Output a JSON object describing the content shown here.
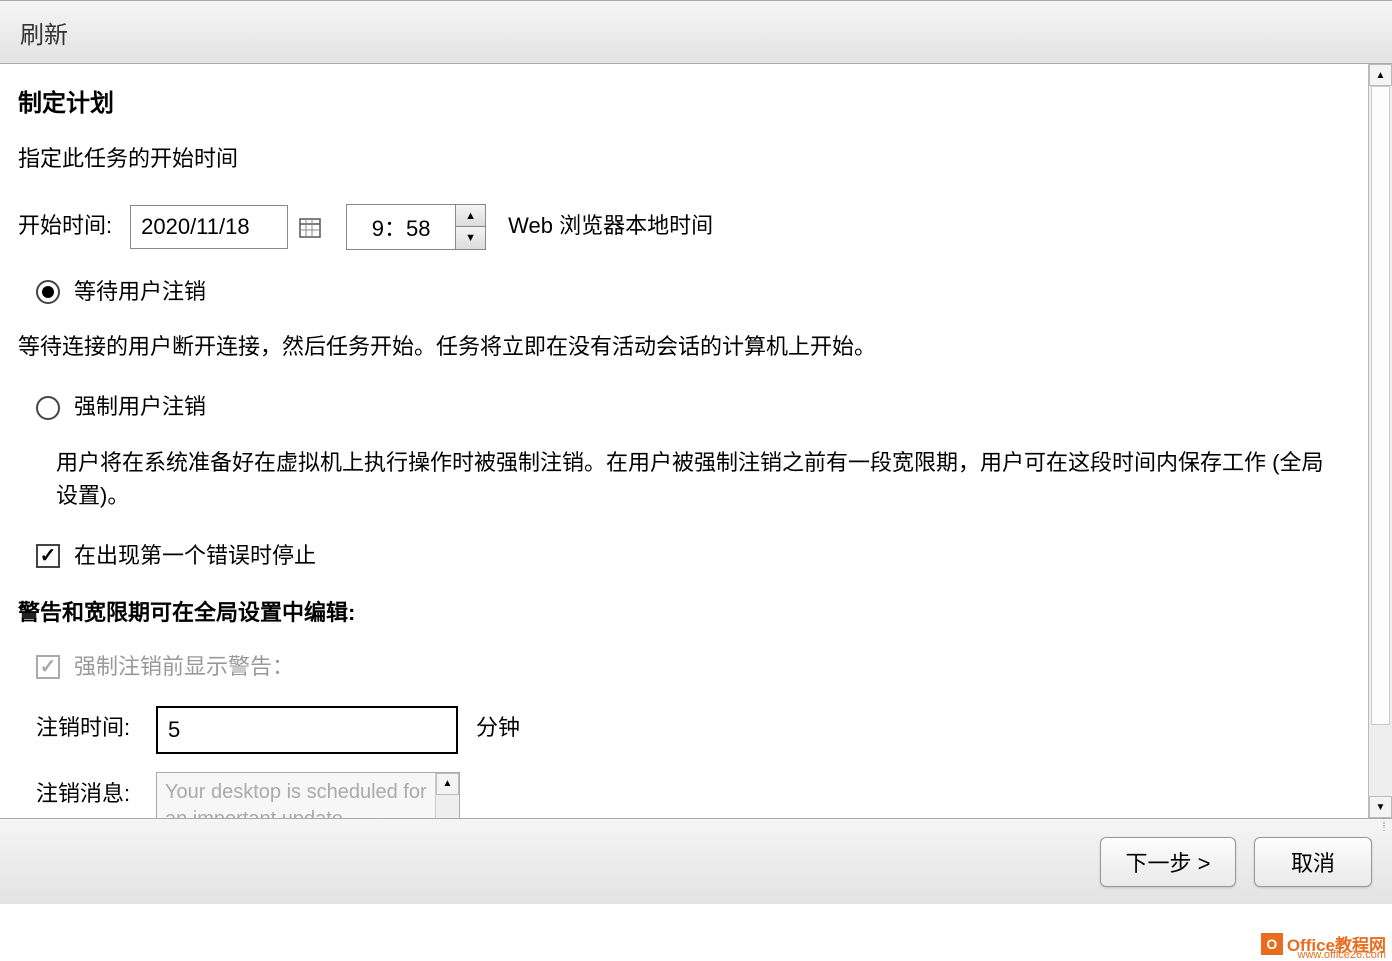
{
  "titlebar": {
    "title": "刷新"
  },
  "plan": {
    "heading": "制定计划",
    "subtitle": "指定此任务的开始时间",
    "start_label": "开始时间:",
    "date_value": "2020/11/18",
    "time_value": "9：58",
    "tz_label": "Web 浏览器本地时间",
    "radio_wait": {
      "label": "等待用户注销",
      "selected": true
    },
    "wait_desc": "等待连接的用户断开连接，然后任务开始。任务将立即在没有活动会话的计算机上开始。",
    "radio_force": {
      "label": "强制用户注销",
      "selected": false
    },
    "force_desc": "用户将在系统准备好在虚拟机上执行操作时被强制注销。在用户被强制注销之前有一段宽限期，用户可在这段时间内保存工作 (全局设置)。",
    "check_stop": {
      "label": "在出现第一个错误时停止",
      "checked": true
    }
  },
  "warning": {
    "heading": "警告和宽限期可在全局设置中编辑:",
    "check_before": {
      "label": "强制注销前显示警告：",
      "checked": true,
      "disabled": true
    },
    "logoff_time_label": "注销时间:",
    "logoff_time_value": "5",
    "logoff_time_unit": "分钟",
    "logoff_msg_label": "注销消息:",
    "logoff_msg_value": "Your desktop is scheduled for an important update"
  },
  "footer": {
    "next": "下一步 >",
    "cancel": "取消"
  },
  "watermark": {
    "brand_o": "O",
    "brand": "Office教程网",
    "url": "www.office26.com"
  }
}
